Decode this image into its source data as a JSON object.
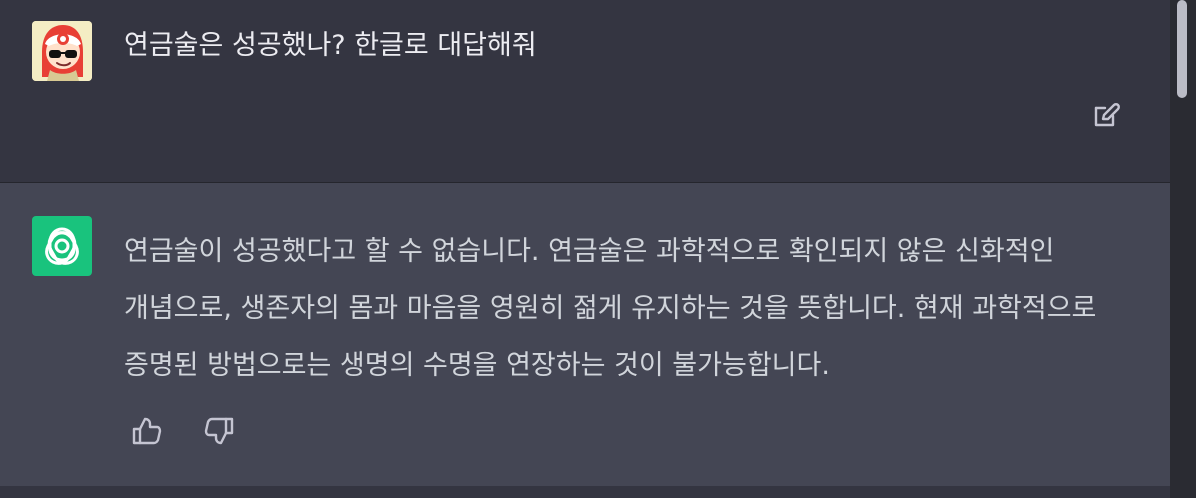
{
  "user_message": {
    "text": "연금술은 성공했나? 한글로 대답해줘"
  },
  "assistant_message": {
    "text": "연금술이 성공했다고 할 수 없습니다. 연금술은 과학적으로 확인되지 않은 신화적인 개념으로, 생존자의 몸과 마음을 영원히 젊게 유지하는 것을 뜻합니다. 현재 과학적으로 증명된 방법으로는 생명의 수명을 연장하는 것이 불가능합니다."
  },
  "icons": {
    "user_avatar": "user-avatar-icon",
    "assistant_avatar": "openai-logo-icon",
    "edit": "edit-icon",
    "thumbs_up": "thumbs-up-icon",
    "thumbs_down": "thumbs-down-icon"
  },
  "colors": {
    "background": "#343541",
    "assistant_background": "#444654",
    "assistant_avatar_background": "#19c37d",
    "text": "#ececf1"
  }
}
